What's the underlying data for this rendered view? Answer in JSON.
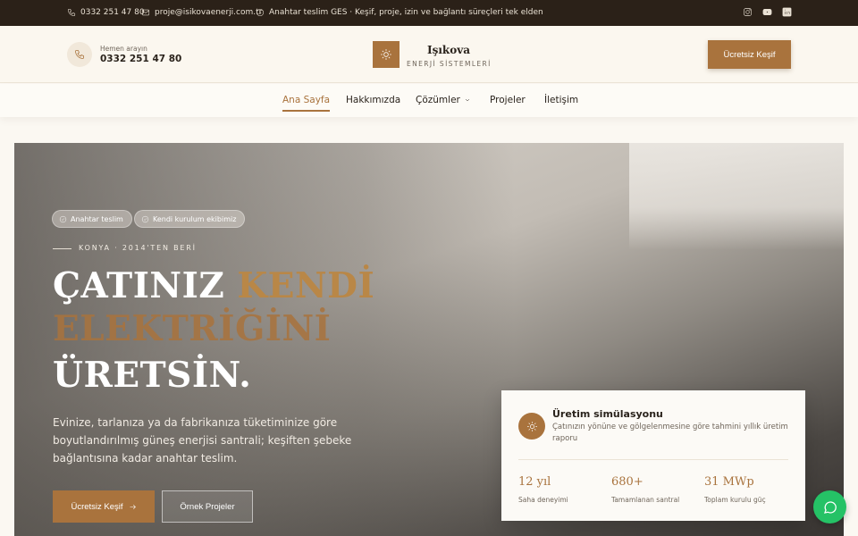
{
  "topbar": {
    "phone": "0332 251 47 80",
    "email": "proje@isikovaenerji.com.tr",
    "info": "Anahtar teslim GES · Keşif, proje, izin ve bağlantı süreçleri tek elden",
    "social": [
      "instagram-icon",
      "youtube-icon",
      "linkedin-icon"
    ]
  },
  "header": {
    "call_label": "Hemen arayın",
    "call_number": "0332 251 47 80",
    "logo_name": "Işıkova",
    "logo_sub": "ENERJİ SİSTEMLERİ",
    "cta": "Ücretsiz Keşif"
  },
  "nav": {
    "items": [
      "Ana Sayfa",
      "Hakkımızda",
      "Çözümler",
      "Projeler",
      "İletişim"
    ],
    "active": "Ana Sayfa"
  },
  "hero": {
    "pills": [
      "Anahtar teslim",
      "Kendi kurulum ekibimiz"
    ],
    "eyebrow": "KONYA · 2014'TEN BERİ",
    "title_l1_a": "ÇATINIZ ",
    "title_l1_b": "KENDİ",
    "title_l2": "ELEKTRİĞİNİ",
    "title_l3": "ÜRETSİN.",
    "description": "Evinize, tarlanıza ya da fabrikanıza tüketiminize göre boyutlandırılmış güneş enerjisi santrali; keşiften şebeke bağlantısına kadar anahtar teslim.",
    "primary_cta": "Ücretsiz Keşif",
    "secondary_cta": "Örnek Projeler"
  },
  "simulation": {
    "title": "Üretim simülasyonu",
    "description": "Çatınızın yönüne ve gölgelenmesine göre tahmini yıllık üretim raporu",
    "stats": [
      {
        "value": "12 yıl",
        "label": "Saha deneyimi"
      },
      {
        "value": "680+",
        "label": "Tamamlanan santral"
      },
      {
        "value": "31 MWp",
        "label": "Toplam kurulu güç"
      }
    ]
  },
  "colors": {
    "accent": "#a9733d",
    "topbar": "#2b2118",
    "whatsapp": "#25c266"
  }
}
